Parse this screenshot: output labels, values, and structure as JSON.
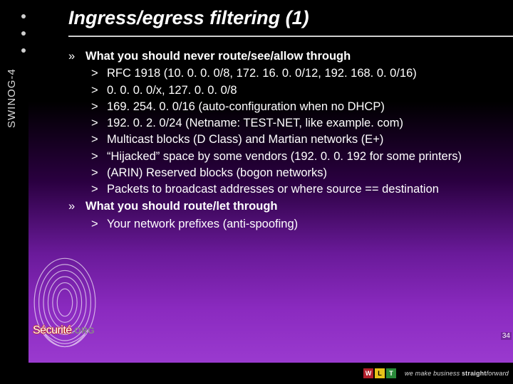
{
  "sidebar": {
    "label": "SWINOG-4"
  },
  "title": "Ingress/egress filtering (1)",
  "sections": [
    {
      "heading": "What you should never route/see/allow through",
      "items": [
        "RFC 1918 (10. 0. 0. 0/8, 172. 16. 0. 0/12, 192. 168. 0. 0/16)",
        "0. 0. 0. 0/x, 127. 0. 0. 0/8",
        "169. 254. 0. 0/16 (auto-configuration when no DHCP)",
        "192. 0. 2. 0/24 (Netname: TEST-NET, like example. com)",
        "Multicast blocks (D Class) and Martian networks (E+)",
        "“Hijacked” space by some vendors (192. 0. 0. 192 for some printers)",
        "(ARIN) Reserved blocks (bogon networks)",
        "Packets to broadcast addresses or where source == destination"
      ]
    },
    {
      "heading": "What you should route/let through",
      "items": [
        "Your network prefixes (anti-spoofing)"
      ]
    }
  ],
  "logo": {
    "brand": "Sécurité",
    "suffix": ".ORG"
  },
  "footer": {
    "squares": [
      "W",
      "L",
      "T"
    ],
    "tagline_pre": "we make business ",
    "tagline_bold": "straight",
    "tagline_post": "forward"
  },
  "page_number": "34",
  "glyphs": {
    "section": "»",
    "item": ">"
  }
}
